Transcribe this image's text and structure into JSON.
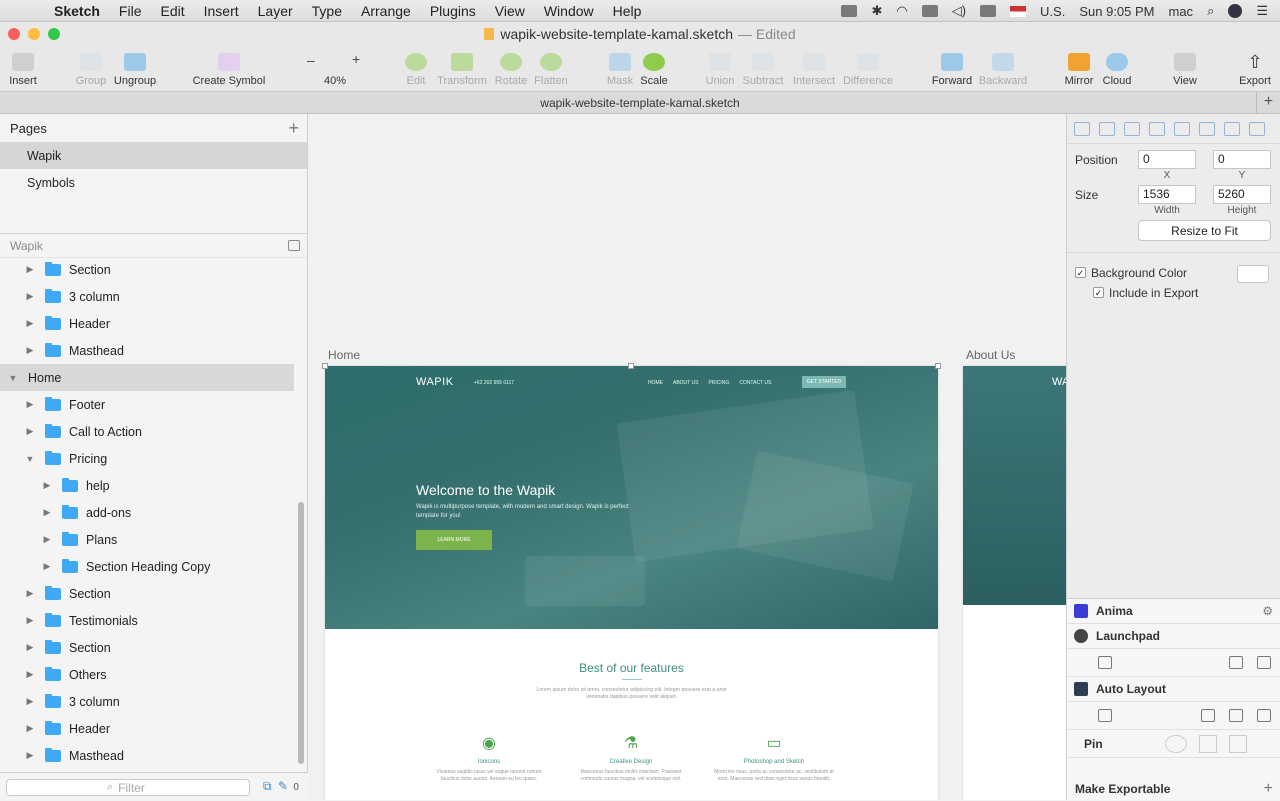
{
  "menubar": {
    "app_name": "Sketch",
    "items": [
      "File",
      "Edit",
      "Insert",
      "Layer",
      "Type",
      "Arrange",
      "Plugins",
      "View",
      "Window",
      "Help"
    ],
    "input_source": "U.S.",
    "clock": "Sun 9:05 PM",
    "user": "mac"
  },
  "window": {
    "title": "wapik-website-template-kamal.sketch",
    "title_suffix": "— Edited"
  },
  "toolbar": {
    "insert": "Insert",
    "group": "Group",
    "ungroup": "Ungroup",
    "create_symbol": "Create Symbol",
    "zoom_minus": "–",
    "zoom_plus": "+",
    "zoom": "40%",
    "edit": "Edit",
    "transform": "Transform",
    "rotate": "Rotate",
    "flatten": "Flatten",
    "mask": "Mask",
    "scale": "Scale",
    "union": "Union",
    "subtract": "Subtract",
    "intersect": "Intersect",
    "difference": "Difference",
    "forward": "Forward",
    "backward": "Backward",
    "mirror": "Mirror",
    "cloud": "Cloud",
    "view": "View",
    "export": "Export"
  },
  "doc_tab": {
    "label": "wapik-website-template-kamal.sketch",
    "add": "+"
  },
  "pages_panel": {
    "title": "Pages",
    "add": "+",
    "pages": [
      {
        "label": "Wapik",
        "selected": true
      },
      {
        "label": "Symbols",
        "selected": false
      }
    ]
  },
  "layers_panel": {
    "title": "Wapik",
    "layers": [
      {
        "label": "Section",
        "depth": 1,
        "expanded": false,
        "folder": true
      },
      {
        "label": "3 column",
        "depth": 1,
        "expanded": false,
        "folder": true
      },
      {
        "label": "Header",
        "depth": 1,
        "expanded": false,
        "folder": true
      },
      {
        "label": "Masthead",
        "depth": 1,
        "expanded": false,
        "folder": true
      },
      {
        "label": "Home",
        "depth": 0,
        "expanded": true,
        "folder": false,
        "selected": true
      },
      {
        "label": "Footer",
        "depth": 1,
        "expanded": false,
        "folder": true
      },
      {
        "label": "Call to Action",
        "depth": 1,
        "expanded": false,
        "folder": true
      },
      {
        "label": "Pricing",
        "depth": 1,
        "expanded": true,
        "folder": true
      },
      {
        "label": "help",
        "depth": 2,
        "expanded": false,
        "folder": true
      },
      {
        "label": "add-ons",
        "depth": 2,
        "expanded": false,
        "folder": true
      },
      {
        "label": "Plans",
        "depth": 2,
        "expanded": false,
        "folder": true
      },
      {
        "label": "Section Heading Copy",
        "depth": 2,
        "expanded": false,
        "folder": true
      },
      {
        "label": "Section",
        "depth": 1,
        "expanded": false,
        "folder": true
      },
      {
        "label": "Testimonials",
        "depth": 1,
        "expanded": false,
        "folder": true
      },
      {
        "label": "Section",
        "depth": 1,
        "expanded": false,
        "folder": true
      },
      {
        "label": "Others",
        "depth": 1,
        "expanded": false,
        "folder": true
      },
      {
        "label": "3 column",
        "depth": 1,
        "expanded": false,
        "folder": true
      },
      {
        "label": "Header",
        "depth": 1,
        "expanded": false,
        "folder": true
      },
      {
        "label": "Masthead",
        "depth": 1,
        "expanded": false,
        "folder": true
      }
    ],
    "filter_placeholder": "Filter",
    "filter_count": "0"
  },
  "canvas": {
    "artboard_home_label": "Home",
    "artboard_about_label": "About Us",
    "site": {
      "logo": "WAPIK",
      "phone": "+62 202 555 0117",
      "nav": [
        "HOME",
        "ABOUT US",
        "PRICING",
        "CONTACT US"
      ],
      "nav_cta": "GET STARTED",
      "hero_title": "Welcome to the Wapik",
      "hero_sub": "Wapik is multipurpose template, with modern and smart design. Wapik is perfect template for you!",
      "hero_button": "LEARN MORE",
      "features_title": "Best of our features",
      "features_sub": "Lorem ipsum dolor sit amet, consectetur adipiscing elit. Integer posuere erat a ante venenatis dapibus posuere velit aliquet.",
      "features": [
        {
          "title": "Ionicons",
          "desc": "Vivamus sagittis lacus vel augue laoreet rutrum faucibus dolor auctor. Aenean eu leo quam.",
          "icon": "target-icon"
        },
        {
          "title": "Creative Design",
          "desc": "Maecenas faucibus mollis interdum. Praesent commodo cursus magna, vel scelerisque nisl.",
          "icon": "flask-icon"
        },
        {
          "title": "Photoshop and Sketch",
          "desc": "Morbi leo risus, porta ac consectetur ac, vestibulum at eros. Maecenas sed diam eget risus varius blandit.",
          "icon": "browser-icon"
        }
      ]
    },
    "about_logo": "WA"
  },
  "inspector": {
    "position_label": "Position",
    "x": "0",
    "y": "0",
    "x_label": "X",
    "y_label": "Y",
    "size_label": "Size",
    "width": "1536",
    "height": "5260",
    "width_label": "Width",
    "height_label": "Height",
    "resize_to_fit": "Resize to Fit",
    "background_color": "Background Color",
    "include_in_export": "Include in Export"
  },
  "plugins": {
    "anima": "Anima",
    "launchpad": "Launchpad",
    "auto_layout": "Auto Layout",
    "pin": "Pin",
    "make_exportable": "Make Exportable"
  },
  "colors": {
    "accent": "#3fa9f5",
    "hero_teal": "#2d6d6b",
    "green_button": "#7cb44c"
  }
}
